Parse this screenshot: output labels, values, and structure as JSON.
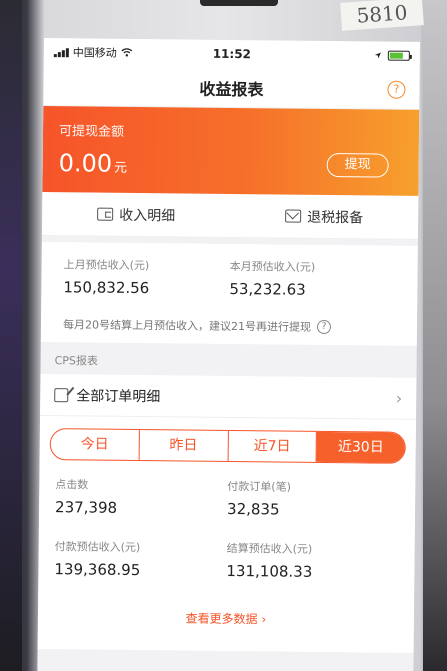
{
  "photo": {
    "sticker_text": "5810"
  },
  "statusbar": {
    "carrier": "中国移动",
    "time": "11:52"
  },
  "navbar": {
    "title": "收益报表",
    "help_glyph": "?"
  },
  "banner": {
    "label": "可提现金额",
    "amount": "0.00",
    "unit": "元",
    "withdraw_label": "提现"
  },
  "actions": [
    {
      "label": "收入明细",
      "icon": "wallet-icon"
    },
    {
      "label": "退税报备",
      "icon": "envelope-icon"
    }
  ],
  "estimates": {
    "last_month_label": "上月预估收入(元)",
    "last_month_value": "150,832.56",
    "this_month_label": "本月预估收入(元)",
    "this_month_value": "53,232.63",
    "note": "每月20号结算上月预估收入，建议21号再进行提现"
  },
  "cps": {
    "section_label": "CPS报表",
    "orders_label": "全部订单明细",
    "tabs": [
      {
        "label": "今日",
        "active": false
      },
      {
        "label": "昨日",
        "active": false
      },
      {
        "label": "近7日",
        "active": false
      },
      {
        "label": "近30日",
        "active": true
      }
    ],
    "stats": {
      "clicks_label": "点击数",
      "clicks_value": "237,398",
      "orders_label": "付款订单(笔)",
      "orders_value": "32,835",
      "pay_income_label": "付款预估收入(元)",
      "pay_income_value": "139,368.95",
      "settle_income_label": "结算预估收入(元)",
      "settle_income_value": "131,108.33"
    },
    "more_label": "查看更多数据"
  },
  "colors": {
    "accent": "#f6542a",
    "accent_end": "#f7a02c"
  }
}
